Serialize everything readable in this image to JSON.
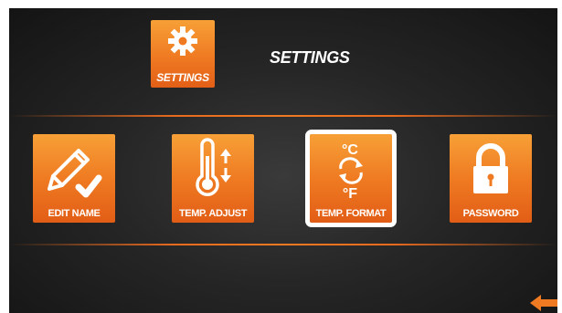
{
  "header": {
    "icon_label": "SETTINGS",
    "title": "SETTINGS"
  },
  "tiles": [
    {
      "label": "EDIT NAME",
      "icon": "pencil-check-icon",
      "selected": false
    },
    {
      "label": "TEMP. ADJUST",
      "icon": "thermometer-icon",
      "selected": false
    },
    {
      "label": "TEMP. FORMAT",
      "icon": "temperature-unit-swap-icon",
      "selected": true
    },
    {
      "label": "PASSWORD",
      "icon": "padlock-icon",
      "selected": false
    }
  ],
  "footer": {
    "back_icon": "back-arrow-icon"
  },
  "colors": {
    "accent": "#ef7a22",
    "accent_dark": "#e35f17",
    "background": "#262626",
    "selection": "#ffffff"
  }
}
